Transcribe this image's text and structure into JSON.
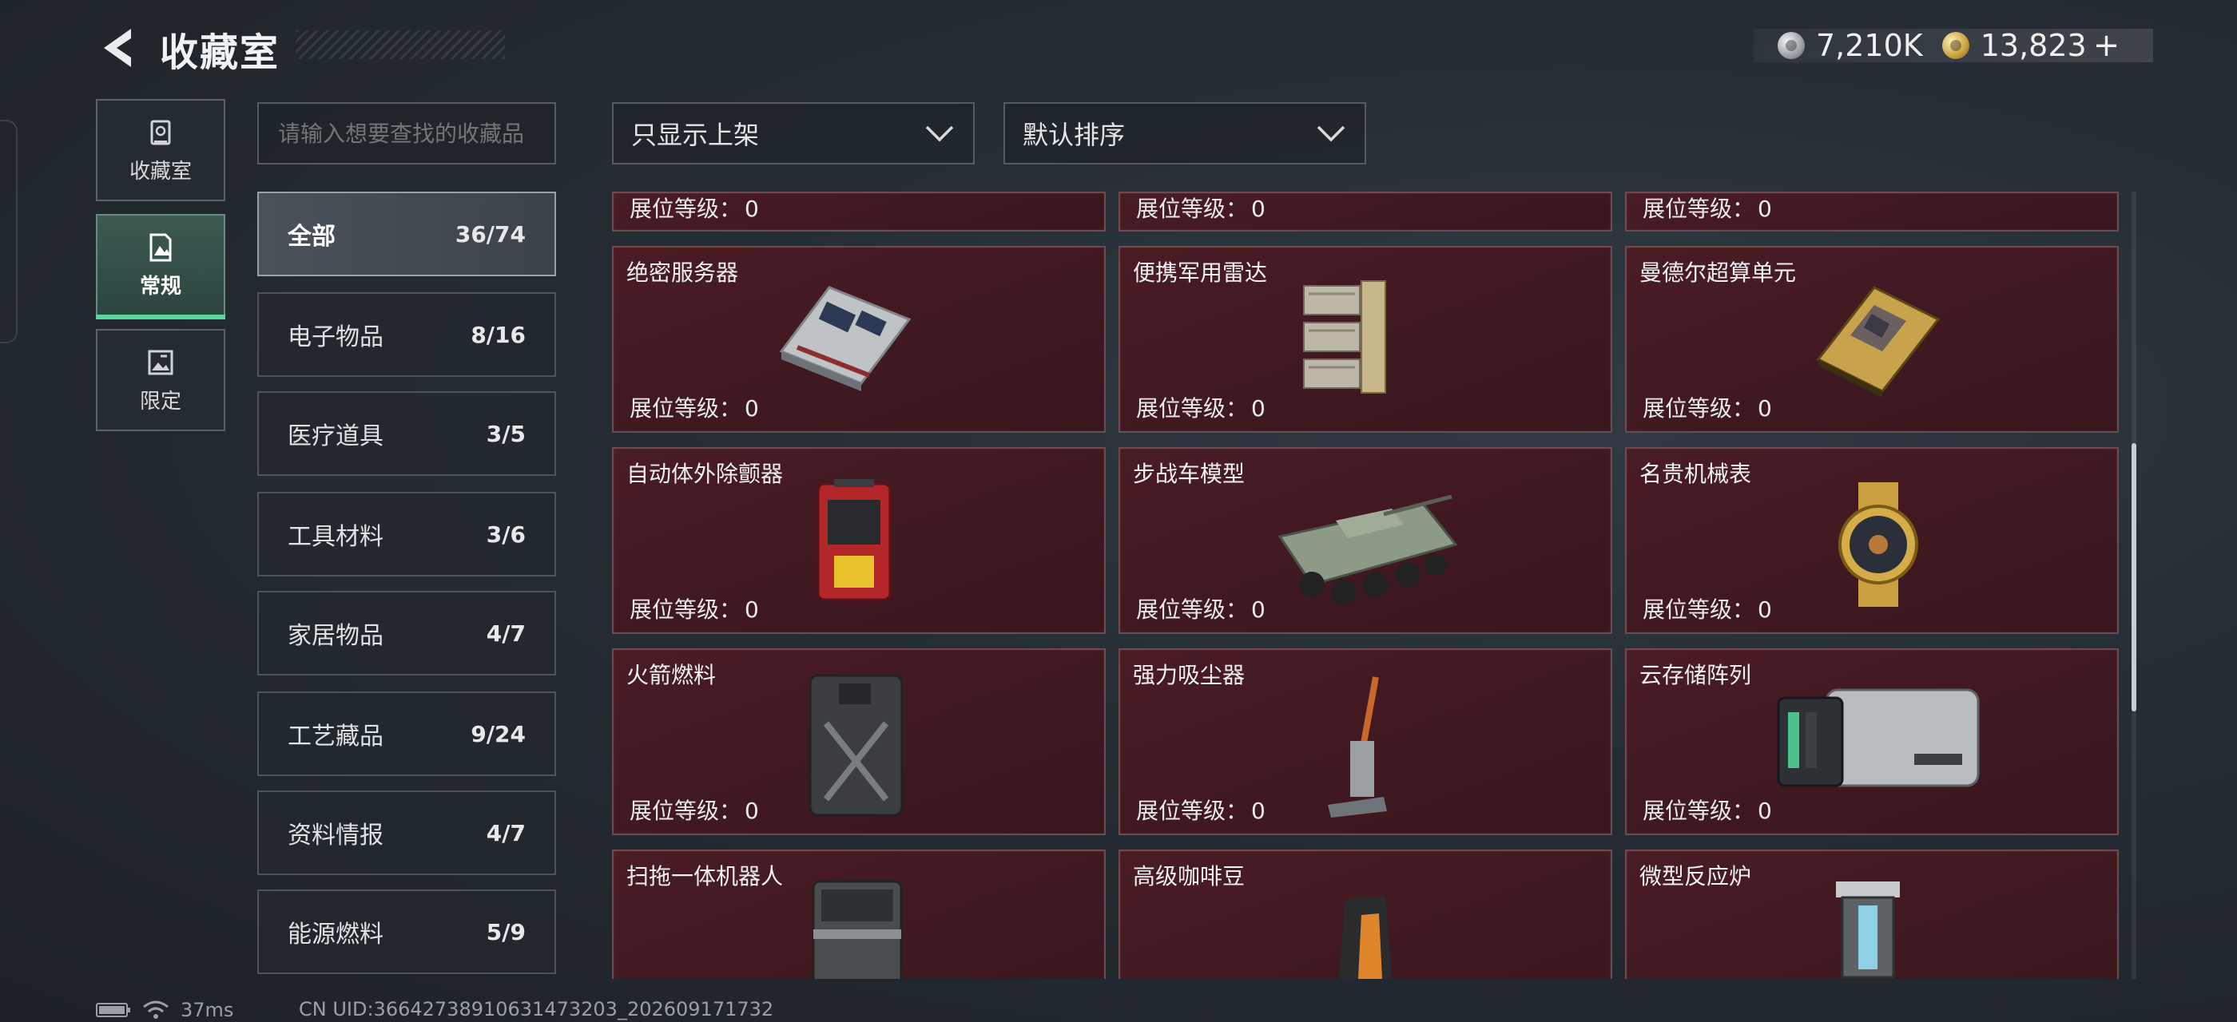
{
  "header": {
    "title": "收藏室",
    "currencies": [
      {
        "icon": "silver-coin-icon",
        "value": "7,210K"
      },
      {
        "icon": "gold-coin-icon",
        "value": "13,823"
      }
    ],
    "plus": "+"
  },
  "nav": [
    {
      "id": "collection-room",
      "label": "收藏室",
      "icon": "vault-icon",
      "active": false
    },
    {
      "id": "regular",
      "label": "常规",
      "icon": "landscape-icon",
      "active": true
    },
    {
      "id": "limited",
      "label": "限定",
      "icon": "image-icon",
      "active": false
    }
  ],
  "search": {
    "placeholder": "请输入想要查找的收藏品"
  },
  "categories": [
    {
      "label": "全部",
      "count": "36/74",
      "active": true
    },
    {
      "label": "电子物品",
      "count": "8/16"
    },
    {
      "label": "医疗道具",
      "count": "3/5"
    },
    {
      "label": "工具材料",
      "count": "3/6"
    },
    {
      "label": "家居物品",
      "count": "4/7"
    },
    {
      "label": "工艺藏品",
      "count": "9/24"
    },
    {
      "label": "资料情报",
      "count": "4/7"
    },
    {
      "label": "能源燃料",
      "count": "5/9"
    }
  ],
  "filters": {
    "listing": "只显示上架",
    "sort": "默认排序"
  },
  "level_label": "展位等级：",
  "partial_row": [
    {
      "level": "0"
    },
    {
      "level": "0"
    },
    {
      "level": "0"
    }
  ],
  "items": [
    {
      "name": "绝密服务器",
      "level": "0",
      "icon": "server-icon"
    },
    {
      "name": "便携军用雷达",
      "level": "0",
      "icon": "radar-icon"
    },
    {
      "name": "曼德尔超算单元",
      "level": "0",
      "icon": "compute-unit-icon"
    },
    {
      "name": "自动体外除颤器",
      "level": "0",
      "icon": "defibrillator-icon"
    },
    {
      "name": "步战车模型",
      "level": "0",
      "icon": "ifv-model-icon"
    },
    {
      "name": "名贵机械表",
      "level": "0",
      "icon": "watch-icon"
    },
    {
      "name": "火箭燃料",
      "level": "0",
      "icon": "fuel-can-icon"
    },
    {
      "name": "强力吸尘器",
      "level": "0",
      "icon": "vacuum-icon"
    },
    {
      "name": "云存储阵列",
      "level": "0",
      "icon": "storage-array-icon"
    },
    {
      "name": "扫拖一体机器人",
      "level": "",
      "icon": "robot-cleaner-icon"
    },
    {
      "name": "高级咖啡豆",
      "level": "",
      "icon": "coffee-bag-icon"
    },
    {
      "name": "微型反应炉",
      "level": "",
      "icon": "reactor-icon"
    }
  ],
  "status": {
    "ping": "37ms",
    "uid": "CN UID:36642738910631473203_202609171732"
  },
  "colors": {
    "card_bg": "#4a1c24",
    "active_accent": "#58d49e"
  }
}
